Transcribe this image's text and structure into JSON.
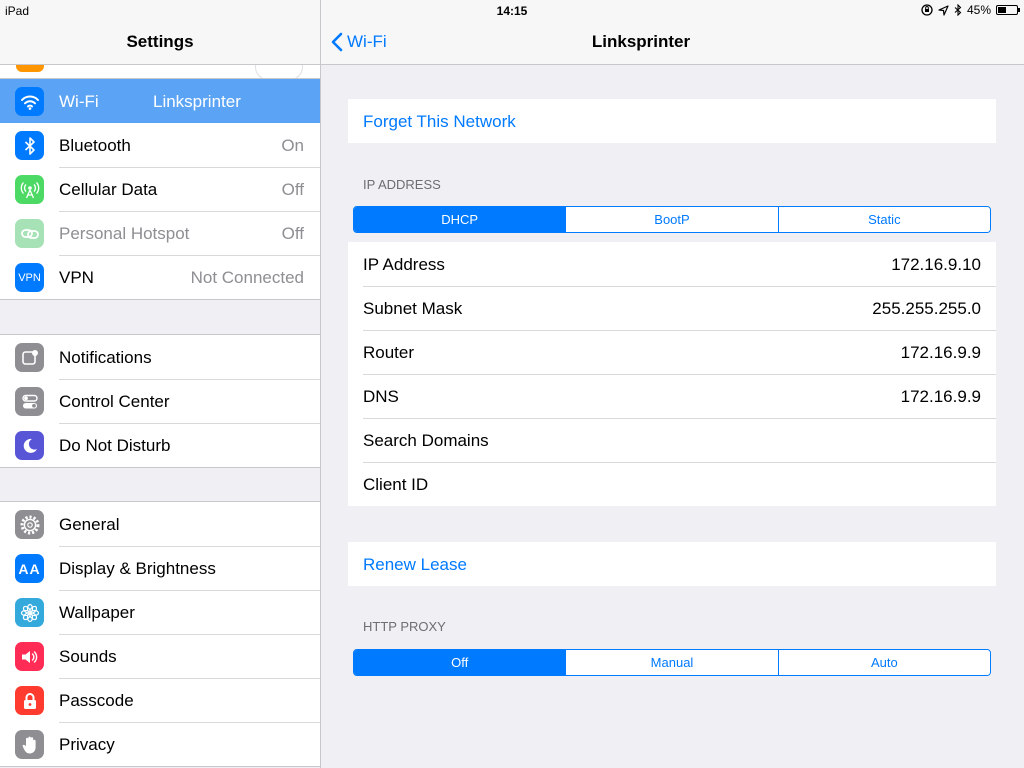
{
  "status_bar": {
    "device": "iPad",
    "time": "14:15",
    "battery": "45%",
    "battery_level": 0.45
  },
  "left_pane": {
    "title": "Settings",
    "groups": [
      {
        "items": [
          {
            "label": "Wi-Fi",
            "value": "Linksprinter",
            "icon": "wifi-icon",
            "color": "#007aff",
            "selected": true
          },
          {
            "label": "Bluetooth",
            "value": "On",
            "icon": "bluetooth-icon",
            "color": "#007aff"
          },
          {
            "label": "Cellular Data",
            "value": "Off",
            "icon": "cellular-icon",
            "color": "#4cd964"
          },
          {
            "label": "Personal Hotspot",
            "value": "Off",
            "icon": "hotspot-icon",
            "color": "#a6e2b5",
            "disabled": true
          },
          {
            "label": "VPN",
            "value": "Not Connected",
            "icon": "vpn-icon",
            "icon_text": "VPN",
            "color": "#007aff"
          }
        ]
      },
      {
        "items": [
          {
            "label": "Notifications",
            "icon": "notifications-icon",
            "color": "#8e8e93"
          },
          {
            "label": "Control Center",
            "icon": "control-center-icon",
            "color": "#8e8e93"
          },
          {
            "label": "Do Not Disturb",
            "icon": "moon-icon",
            "color": "#5856d6"
          }
        ]
      },
      {
        "items": [
          {
            "label": "General",
            "icon": "gear-icon",
            "color": "#8e8e93"
          },
          {
            "label": "Display & Brightness",
            "icon": "display-icon",
            "icon_text": "AA",
            "color": "#007aff"
          },
          {
            "label": "Wallpaper",
            "icon": "wallpaper-icon",
            "color": "#34aadc"
          },
          {
            "label": "Sounds",
            "icon": "speaker-icon",
            "color": "#ff2d55"
          },
          {
            "label": "Passcode",
            "icon": "lock-icon",
            "color": "#ff3b30"
          },
          {
            "label": "Privacy",
            "icon": "hand-icon",
            "color": "#8e8e93"
          }
        ]
      }
    ]
  },
  "right_pane": {
    "back_label": "Wi-Fi",
    "title": "Linksprinter",
    "forget_label": "Forget This Network",
    "ip_section_header": "IP ADDRESS",
    "ip_modes": [
      {
        "label": "DHCP",
        "active": true
      },
      {
        "label": "BootP"
      },
      {
        "label": "Static"
      }
    ],
    "ip_rows": [
      {
        "label": "IP Address",
        "value": "172.16.9.10"
      },
      {
        "label": "Subnet Mask",
        "value": "255.255.255.0"
      },
      {
        "label": "Router",
        "value": "172.16.9.9"
      },
      {
        "label": "DNS",
        "value": "172.16.9.9"
      },
      {
        "label": "Search Domains",
        "value": ""
      },
      {
        "label": "Client ID",
        "value": ""
      }
    ],
    "renew_label": "Renew Lease",
    "proxy_section_header": "HTTP PROXY",
    "proxy_modes": [
      {
        "label": "Off",
        "active": true
      },
      {
        "label": "Manual"
      },
      {
        "label": "Auto"
      }
    ]
  },
  "colors": {
    "accent": "#007aff",
    "selection": "#5ba4f5",
    "background": "#efeff4"
  }
}
